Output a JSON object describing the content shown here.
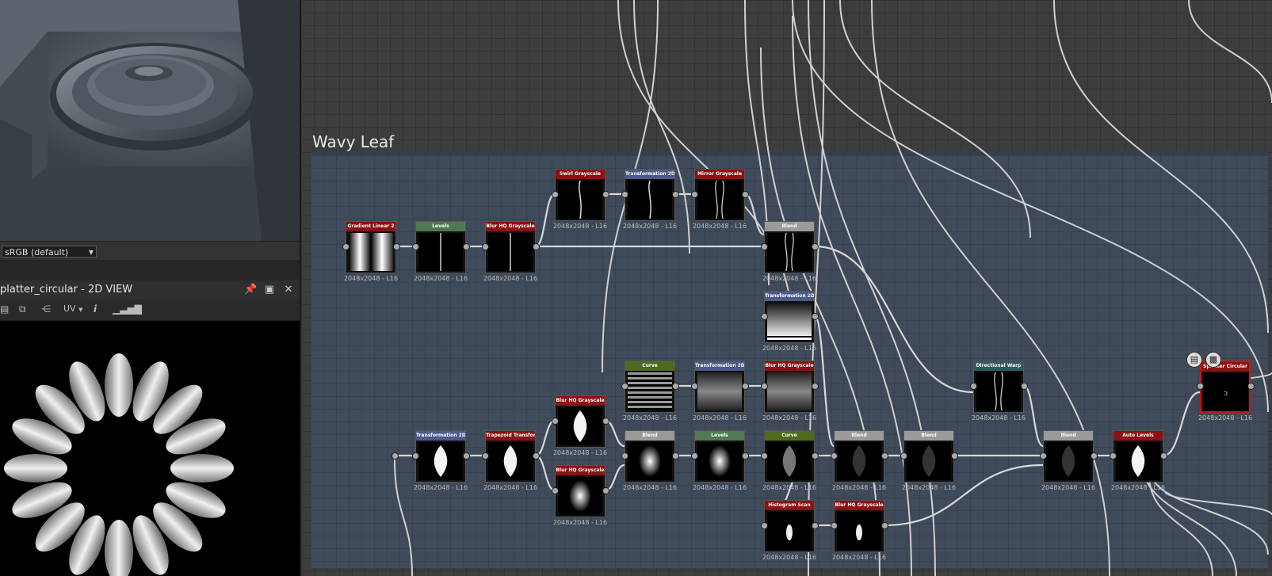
{
  "color_space": "sRGB (default)",
  "panel_2d": {
    "title": "platter_circular - 2D VIEW",
    "uv_label": "UV"
  },
  "frame": {
    "title": "Wavy Leaf"
  },
  "nodes": [
    {
      "id": "n1",
      "title": "Gradient Linear 2",
      "color": "#8a1212",
      "label": "2048x2048 - L16",
      "thumb": "gradient"
    },
    {
      "id": "n2",
      "title": "Levels",
      "color": "#4f7a4f",
      "label": "2048x2048 - L16",
      "thumb": "line"
    },
    {
      "id": "n3",
      "title": "Blur HQ Grayscale",
      "color": "#8a1212",
      "label": "2048x2048 - L16",
      "thumb": "line"
    },
    {
      "id": "n4",
      "title": "Swirl Grayscale",
      "color": "#8a1212",
      "label": "2048x2048 - L16",
      "thumb": "wavy"
    },
    {
      "id": "n5",
      "title": "Transformation 2D",
      "color": "#4a5a8a",
      "label": "2048x2048 - L16",
      "thumb": "wavy"
    },
    {
      "id": "n6",
      "title": "Mirror Grayscale",
      "color": "#8a1212",
      "label": "2048x2048 - L16",
      "thumb": "wavy2"
    },
    {
      "id": "n7",
      "title": "Blend",
      "color": "#9a9a9a",
      "label": "2048x2048 - L16",
      "thumb": "wavy2"
    },
    {
      "id": "n8",
      "title": "Transformation 2D",
      "color": "#4a5a8a",
      "label": "2048x2048 - L16",
      "thumb": "vgrad"
    },
    {
      "id": "n9",
      "title": "Curve",
      "color": "#4f6a1f",
      "label": "2048x2048 - L16",
      "thumb": "stripes"
    },
    {
      "id": "n10",
      "title": "Transformation 2D",
      "color": "#4a5a8a",
      "label": "2048x2048 - L16",
      "thumb": "hband"
    },
    {
      "id": "n11",
      "title": "Blur HQ Grayscale",
      "color": "#8a1212",
      "label": "2048x2048 - L16",
      "thumb": "hband"
    },
    {
      "id": "n12",
      "title": "Directional Warp",
      "color": "#2f5a5a",
      "label": "2048x2048 - L16",
      "thumb": "wavy2"
    },
    {
      "id": "n13",
      "title": "Splatter Circular",
      "color": "#8a1212",
      "label": "2048x2048 - L16",
      "thumb": "dot"
    },
    {
      "id": "n14",
      "title": "Transformation 2D",
      "color": "#4a5a8a",
      "label": "2048x2048 - L16",
      "thumb": "leaf"
    },
    {
      "id": "n15",
      "title": "Trapezoid Transform G...",
      "color": "#8a1212",
      "label": "2048x2048 - L16",
      "thumb": "leaf"
    },
    {
      "id": "n16",
      "title": "Blur HQ Grayscale",
      "color": "#8a1212",
      "label": "2048x2048 - L16",
      "thumb": "leaf"
    },
    {
      "id": "n17",
      "title": "Blur HQ Grayscale",
      "color": "#8a1212",
      "label": "2048x2048 - L16",
      "thumb": "blob"
    },
    {
      "id": "n18",
      "title": "Blend",
      "color": "#9a9a9a",
      "label": "2048x2048 - L16",
      "thumb": "blob"
    },
    {
      "id": "n19",
      "title": "Levels",
      "color": "#4f7a4f",
      "label": "2048x2048 - L16",
      "thumb": "blob"
    },
    {
      "id": "n20",
      "title": "Curve",
      "color": "#4f6a1f",
      "label": "2048x2048 - L16",
      "thumb": "leafdim"
    },
    {
      "id": "n21",
      "title": "Blend",
      "color": "#9a9a9a",
      "label": "2048x2048 - L16",
      "thumb": "leafdark"
    },
    {
      "id": "n22",
      "title": "Blend",
      "color": "#9a9a9a",
      "label": "2048x2048 - L16",
      "thumb": "leafdark"
    },
    {
      "id": "n23",
      "title": "Blend",
      "color": "#9a9a9a",
      "label": "2048x2048 - L16",
      "thumb": "leafdark"
    },
    {
      "id": "n24",
      "title": "Auto Levels",
      "color": "#8a1212",
      "label": "2048x2048 - L16",
      "thumb": "leaf"
    },
    {
      "id": "n25",
      "title": "Histogram Scan",
      "color": "#8a1212",
      "label": "2048x2048 - L16",
      "thumb": "small"
    },
    {
      "id": "n26",
      "title": "Blur HQ Grayscale",
      "color": "#8a1212",
      "label": "2048x2048 - L16",
      "thumb": "small"
    }
  ]
}
